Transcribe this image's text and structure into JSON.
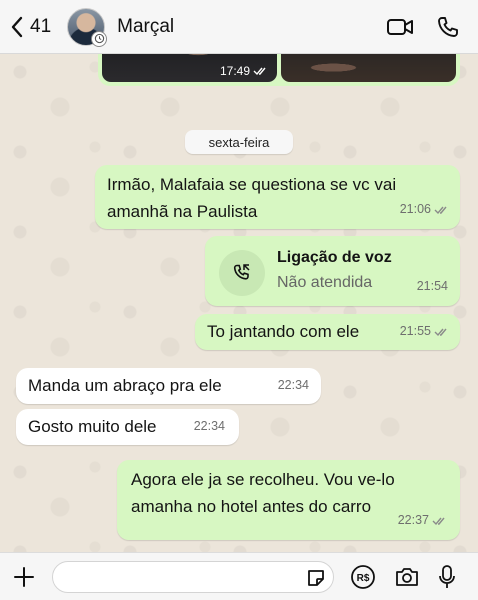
{
  "header": {
    "back_count": "41",
    "contact_name": "Marçal",
    "icons": [
      "back-chevron-icon",
      "video-call-icon",
      "phone-icon"
    ]
  },
  "media": {
    "time": "17:49"
  },
  "date_separator": "sexta-feira",
  "messages": [
    {
      "direction": "out",
      "text": "Irmão, Malafaia se questiona se vc vai amanhã na Paulista",
      "time": "21:06"
    },
    {
      "direction": "out",
      "type": "call",
      "title": "Ligação de voz",
      "subtitle": "Não atendida",
      "time": "21:54"
    },
    {
      "direction": "out",
      "text": "To jantando com ele",
      "time": "21:55"
    },
    {
      "direction": "in",
      "text": "Manda um abraço pra ele",
      "time": "22:34"
    },
    {
      "direction": "in",
      "text": "Gosto muito dele",
      "time": "22:34"
    },
    {
      "direction": "out",
      "text": "Agora ele ja se recolheu. Vou ve-lo amanha no hotel antes do carro",
      "time": "22:37"
    }
  ],
  "input_bar": {
    "placeholder": "",
    "icons": [
      "plus-icon",
      "sticker-icon",
      "payment-icon",
      "camera-icon",
      "microphone-icon"
    ]
  },
  "colors": {
    "outgoing_bubble": "#d7f7c2",
    "incoming_bubble": "#ffffff",
    "wallpaper": "#ece5da",
    "tick_gray": "#8a8a8a"
  }
}
